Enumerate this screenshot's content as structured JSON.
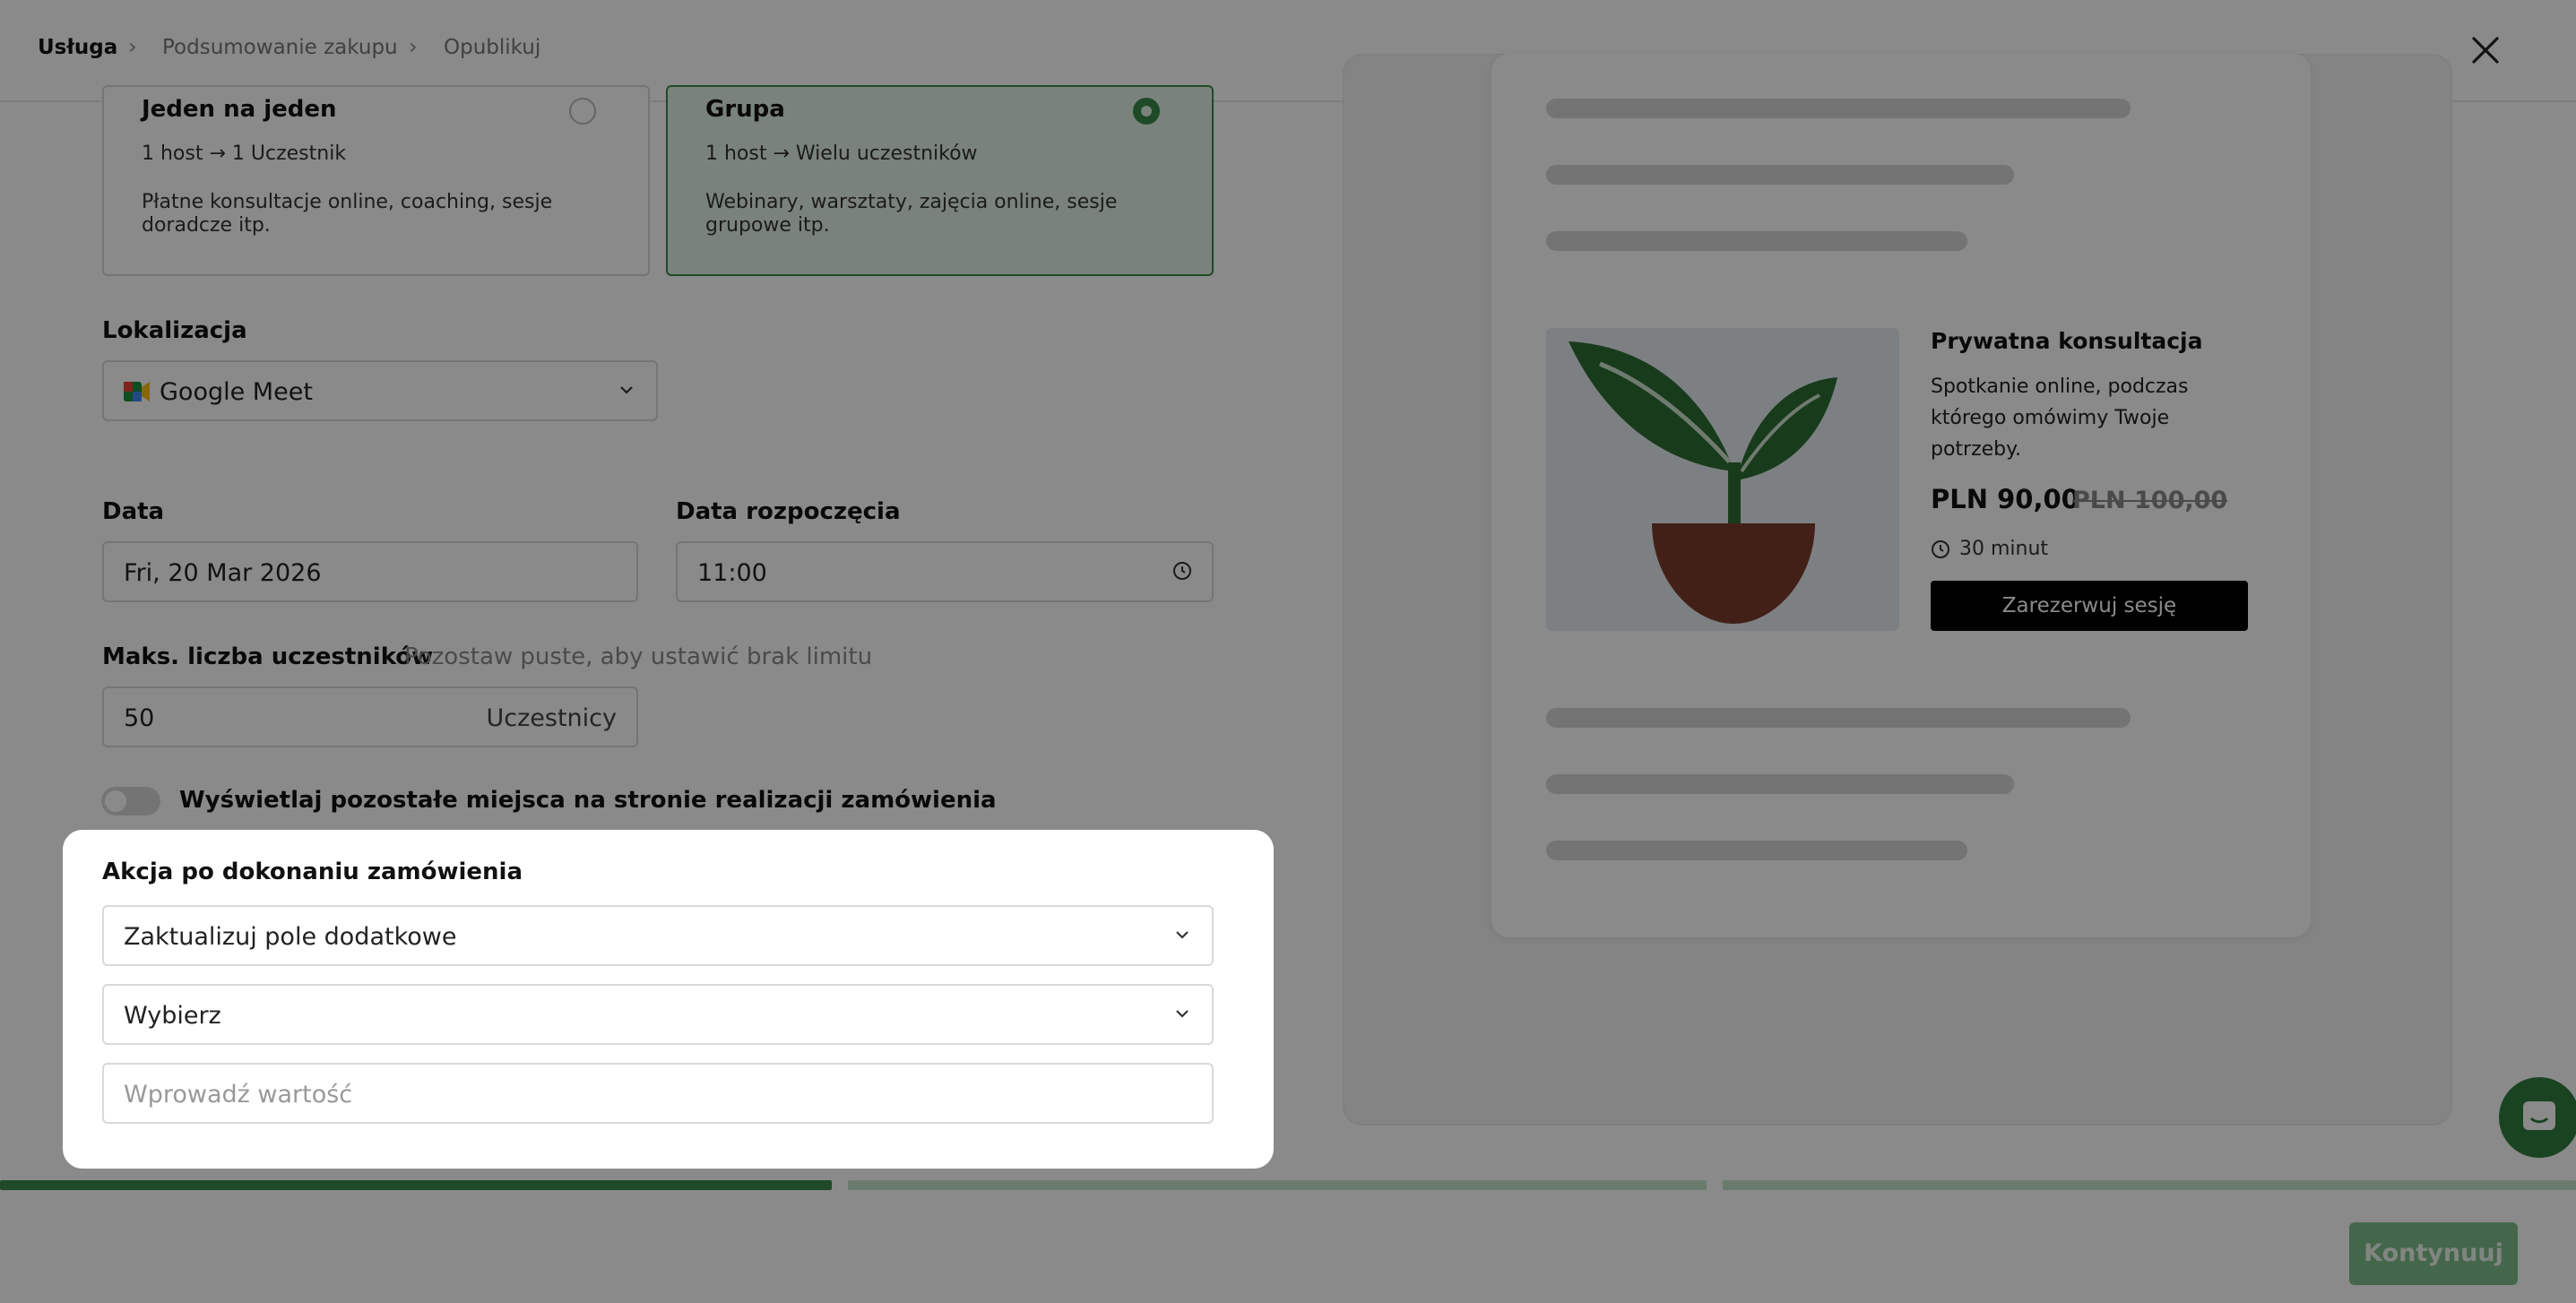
{
  "breadcrumb": [
    "Usługa",
    "Podsumowanie zakupu",
    "Opublikuj"
  ],
  "session_types": [
    {
      "title": "Jeden na jeden",
      "subtitle": "1 host → 1 Uczestnik",
      "description": "Płatne konsultacje online, coaching, sesje doradcze itp.",
      "selected": false
    },
    {
      "title": "Grupa",
      "subtitle": "1 host → Wielu uczestników",
      "description": "Webinary, warsztaty, zajęcia online, sesje grupowe itp.",
      "selected": true
    }
  ],
  "location": {
    "label": "Lokalizacja",
    "value": "Google Meet"
  },
  "date": {
    "label": "Data",
    "value": "Fri, 20 Mar 2026"
  },
  "start_time": {
    "label": "Data rozpoczęcia",
    "value": "11:00"
  },
  "max_participants": {
    "label": "Maks. liczba uczestników",
    "hint": "Pozostaw puste, aby ustawić brak limitu",
    "value": "50",
    "suffix": "Uczestnicy"
  },
  "show_remaining": {
    "label": "Wyświetlaj pozostałe miejsca na stronie realizacji zamówienia",
    "enabled": false
  },
  "modal": {
    "title": "Akcja po dokonaniu zamówienia",
    "action_value": "Zaktualizuj pole dodatkowe",
    "field_value": "Wybierz",
    "value_placeholder": "Wprowadź wartość"
  },
  "preview": {
    "title": "Prywatna konsultacja",
    "description": "Spotkanie online, podczas którego omówimy Twoje potrzeby.",
    "price": "PLN 90,00",
    "old_price": "PLN 100,00",
    "duration": "30 minut",
    "book_label": "Zarezerwuj sesję"
  },
  "progress": {
    "steps": 3,
    "current": 1
  },
  "footer": {
    "continue_label": "Kontynuuj"
  },
  "colors": {
    "accent": "#3a8a4a",
    "accent_light": "#e1f2e4",
    "button_dark": "#000000"
  }
}
